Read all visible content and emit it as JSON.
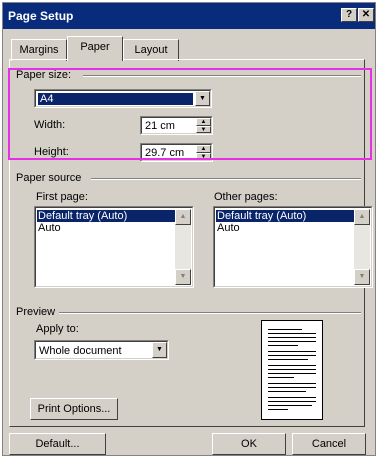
{
  "dialog": {
    "title": "Page Setup",
    "help_button": "?",
    "close_button": "✕"
  },
  "tabs": [
    {
      "label": "Margins",
      "active": false
    },
    {
      "label": "Paper",
      "active": true
    },
    {
      "label": "Layout",
      "active": false
    }
  ],
  "paper_size": {
    "group_label": "Paper size:",
    "selected": "A4",
    "width_label": "Width:",
    "width_value": "21 cm",
    "height_label": "Height:",
    "height_value": "29.7 cm"
  },
  "paper_source": {
    "group_label": "Paper source",
    "first_page_label": "First page:",
    "first_page_items": [
      "Default tray (Auto)",
      "Auto"
    ],
    "other_pages_label": "Other pages:",
    "other_pages_items": [
      "Default tray (Auto)",
      "Auto"
    ]
  },
  "preview": {
    "group_label": "Preview",
    "apply_to_label": "Apply to:",
    "apply_to_value": "Whole document"
  },
  "buttons": {
    "print_options": "Print Options...",
    "default": "Default...",
    "ok": "OK",
    "cancel": "Cancel"
  },
  "highlight_color": "#e630e6",
  "selection_color": "#0a246a",
  "titlebar_color": "#082b7b"
}
